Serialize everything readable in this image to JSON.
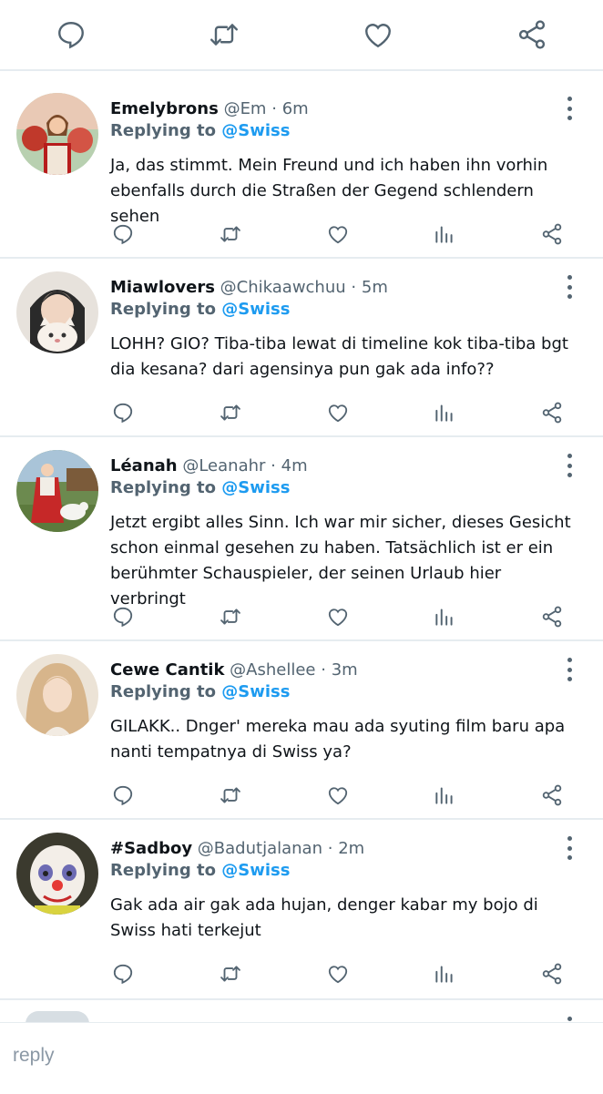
{
  "top_actions": [
    "reply-icon",
    "retweet-icon",
    "like-icon",
    "share-icon"
  ],
  "tweets": [
    {
      "name": "Emelybrons",
      "handle": "@Em",
      "time": "6m",
      "replying_prefix": "Replying to",
      "replying_to": "@Swiss",
      "text": "Ja, das stimmt. Mein Freund und ich haben ihn vorhin ebenfalls durch die Straßen der Gegend schlendern sehen"
    },
    {
      "name": "Miawlovers",
      "handle": "@Chikaawchuu",
      "time": "5m",
      "replying_prefix": "Replying to",
      "replying_to": "@Swiss",
      "text": "LOHH? GIO? Tiba-tiba lewat di timeline kok tiba-tiba bgt dia kesana? dari agensinya pun gak ada info??"
    },
    {
      "name": "Léanah",
      "handle": "@Leanahr",
      "time": "4m",
      "replying_prefix": "Replying to",
      "replying_to": "@Swiss",
      "text": "Jetzt ergibt alles Sinn. Ich war mir sicher, dieses Gesicht schon einmal gesehen zu haben. Tatsächlich ist er ein berühmter Schauspieler, der seinen Urlaub hier verbringt"
    },
    {
      "name": "Cewe Cantik",
      "handle": "@Ashellee",
      "time": "3m",
      "replying_prefix": "Replying to",
      "replying_to": "@Swiss",
      "text": "GILAKK.. Dnger' mereka mau ada syuting film baru apa nanti tempatnya di Swiss ya?"
    },
    {
      "name": "#Sadboy",
      "handle": "@Badutjalanan",
      "time": "2m",
      "replying_prefix": "Replying to",
      "replying_to": "@Swiss",
      "text": "Gak ada air gak ada hujan, denger kabar my bojo di Swiss hati terkejut"
    }
  ],
  "separator": "·",
  "reply_bar": {
    "placeholder": "reply"
  },
  "colors": {
    "accent": "#1d9bf0",
    "muted": "#536471",
    "divider": "#e6ecf0"
  }
}
